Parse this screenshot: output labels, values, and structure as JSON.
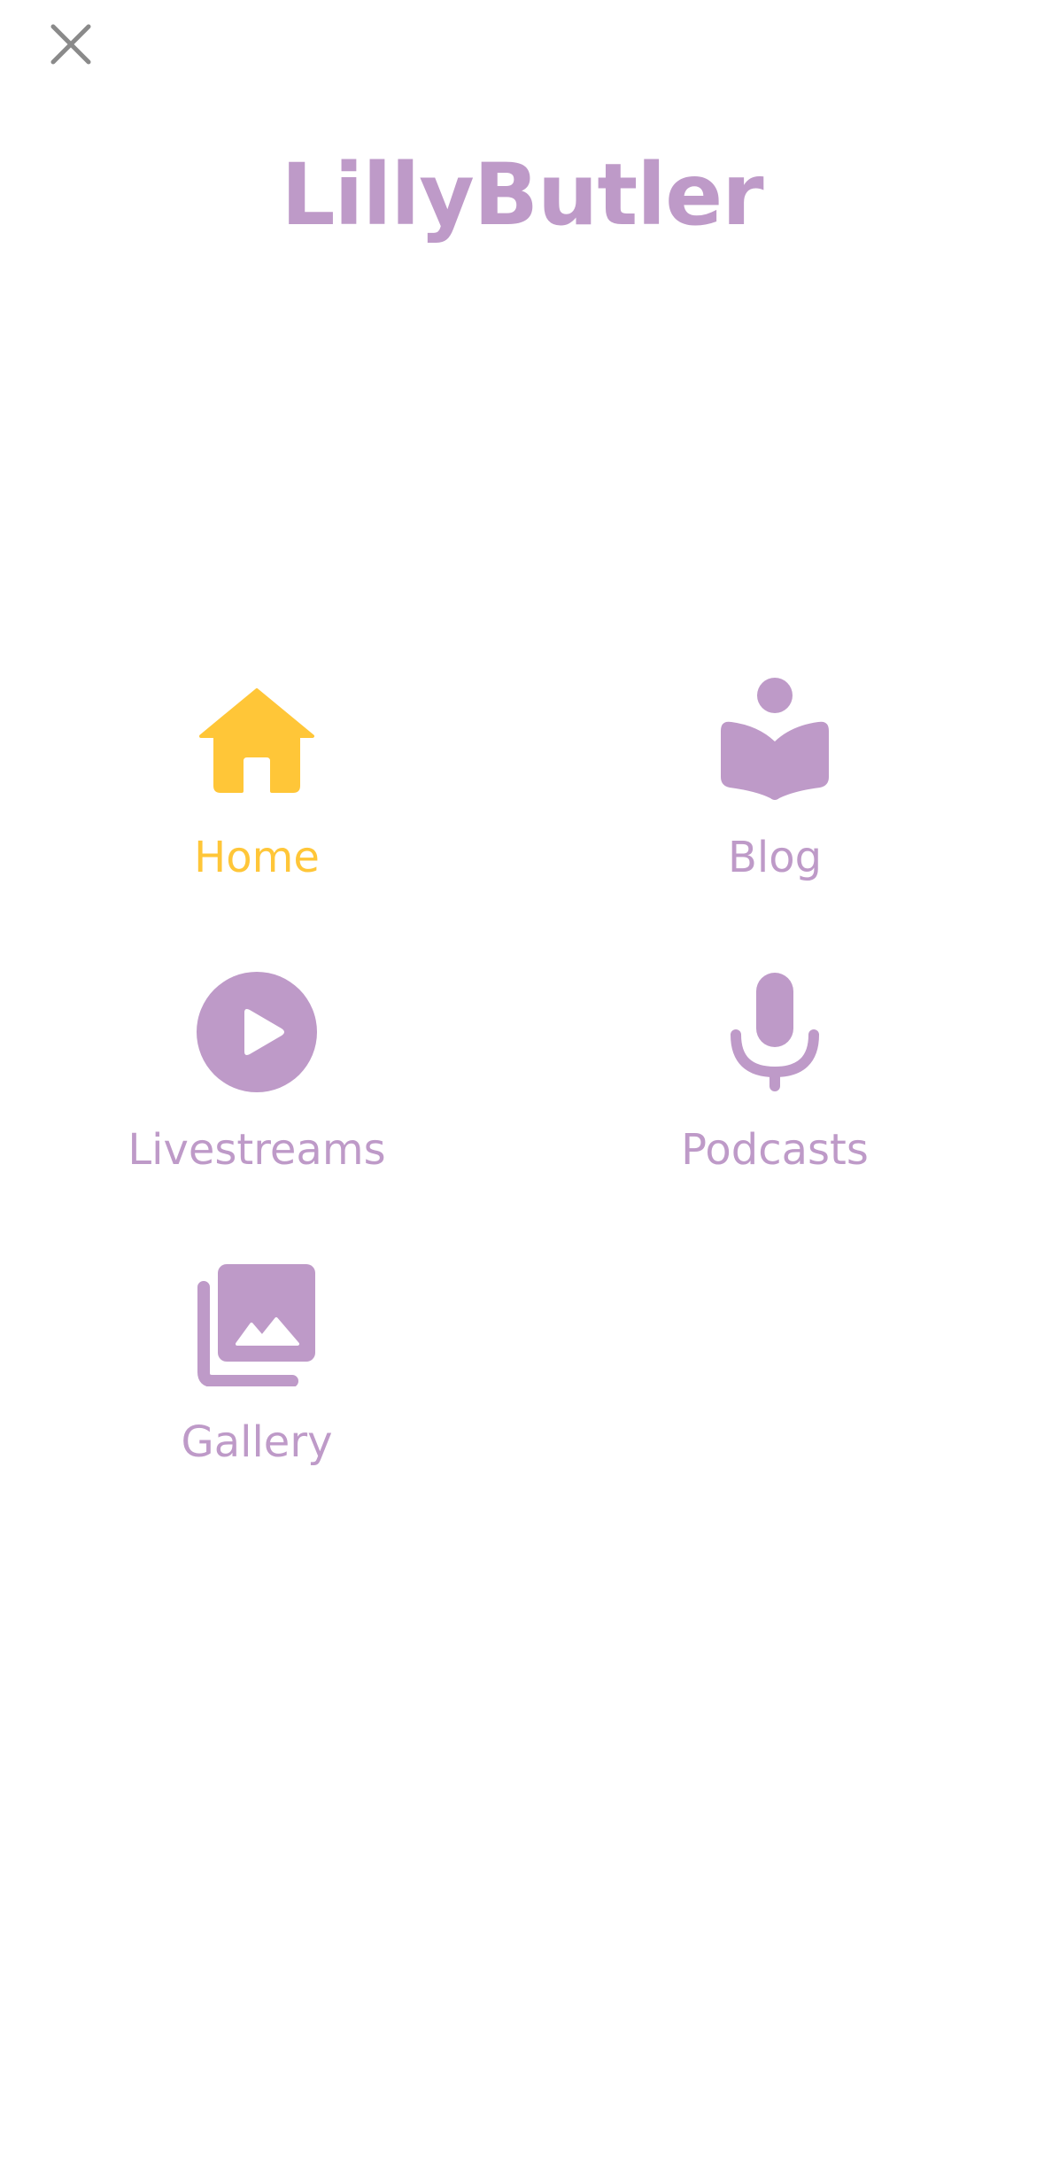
{
  "colors": {
    "active": "#FFC638",
    "accent": "#BE9AC8",
    "close": "#8A8A8A"
  },
  "header": {
    "close_icon": "close-icon",
    "brand_name": "LillyButler"
  },
  "menu": {
    "items": [
      {
        "label": "Home",
        "icon": "home-icon",
        "active": true
      },
      {
        "label": "Blog",
        "icon": "reader-book-icon",
        "active": false
      },
      {
        "label": "Livestreams",
        "icon": "play-circle-icon",
        "active": false
      },
      {
        "label": "Podcasts",
        "icon": "microphone-icon",
        "active": false
      },
      {
        "label": "Gallery",
        "icon": "photo-library-icon",
        "active": false
      }
    ]
  }
}
